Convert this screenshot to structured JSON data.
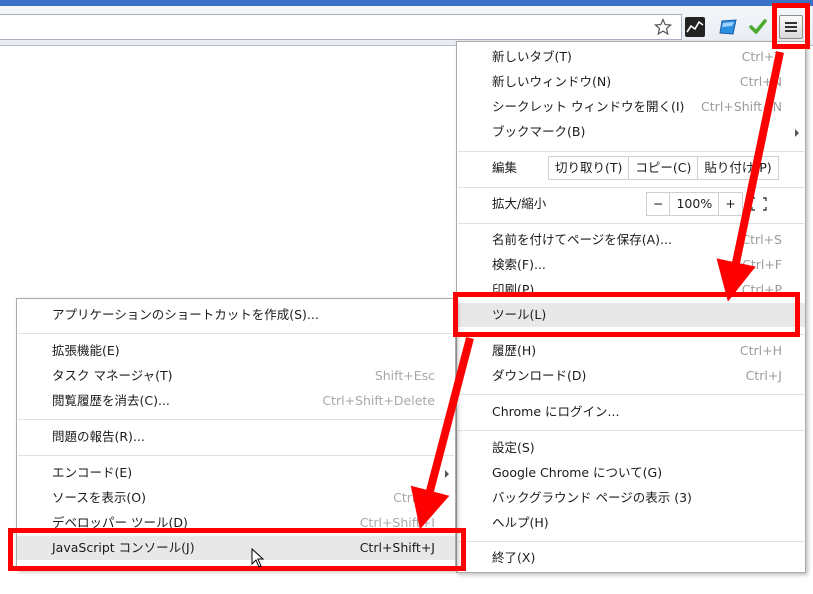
{
  "toolbar": {
    "icons": [
      "star-icon",
      "stock-chart-extension-icon",
      "blue-extension-icon",
      "green-check-extension-icon",
      "hamburger-menu-icon"
    ]
  },
  "main_menu": {
    "new_tab": {
      "label": "新しいタブ(T)",
      "shortcut": "Ctrl+T"
    },
    "new_window": {
      "label": "新しいウィンドウ(N)",
      "shortcut": "Ctrl+N"
    },
    "incognito": {
      "label": "シークレット ウィンドウを開く(I)",
      "shortcut": "Ctrl+Shift+N"
    },
    "bookmarks": {
      "label": "ブックマーク(B)"
    },
    "edit": {
      "label": "編集",
      "cut": "切り取り(T)",
      "copy": "コピー(C)",
      "paste": "貼り付け(P)"
    },
    "zoom": {
      "label": "拡大/縮小",
      "minus": "−",
      "value": "100%",
      "plus": "+"
    },
    "save_page": {
      "label": "名前を付けてページを保存(A)...",
      "shortcut": "Ctrl+S"
    },
    "find": {
      "label": "検索(F)...",
      "shortcut": "Ctrl+F"
    },
    "print": {
      "label": "印刷(P)...",
      "shortcut": "Ctrl+P"
    },
    "tools": {
      "label": "ツール(L)"
    },
    "history": {
      "label": "履歴(H)",
      "shortcut": "Ctrl+H"
    },
    "downloads": {
      "label": "ダウンロード(D)",
      "shortcut": "Ctrl+J"
    },
    "signin": {
      "label": "Chrome にログイン..."
    },
    "settings": {
      "label": "設定(S)"
    },
    "about": {
      "label": "Google Chrome について(G)"
    },
    "background": {
      "label": "バックグラウンド ページの表示 (3)"
    },
    "help": {
      "label": "ヘルプ(H)"
    },
    "exit": {
      "label": "終了(X)"
    }
  },
  "tools_submenu": {
    "create_shortcut": {
      "label": "アプリケーションのショートカットを作成(S)..."
    },
    "extensions": {
      "label": "拡張機能(E)"
    },
    "task_manager": {
      "label": "タスク マネージャ(T)",
      "shortcut": "Shift+Esc"
    },
    "clear_data": {
      "label": "閲覧履歴を消去(C)...",
      "shortcut": "Ctrl+Shift+Delete"
    },
    "report_issue": {
      "label": "問題の報告(R)..."
    },
    "encoding": {
      "label": "エンコード(E)"
    },
    "view_source": {
      "label": "ソースを表示(O)",
      "shortcut": "Ctrl+U"
    },
    "developer_tools": {
      "label": "デベロッパー ツール(D)",
      "shortcut": "Ctrl+Shift+I"
    },
    "js_console": {
      "label": "JavaScript コンソール(J)",
      "shortcut": "Ctrl+Shift+J"
    }
  },
  "colors": {
    "annotation": "#ff0000",
    "accent_strip": "#3a72c7"
  }
}
